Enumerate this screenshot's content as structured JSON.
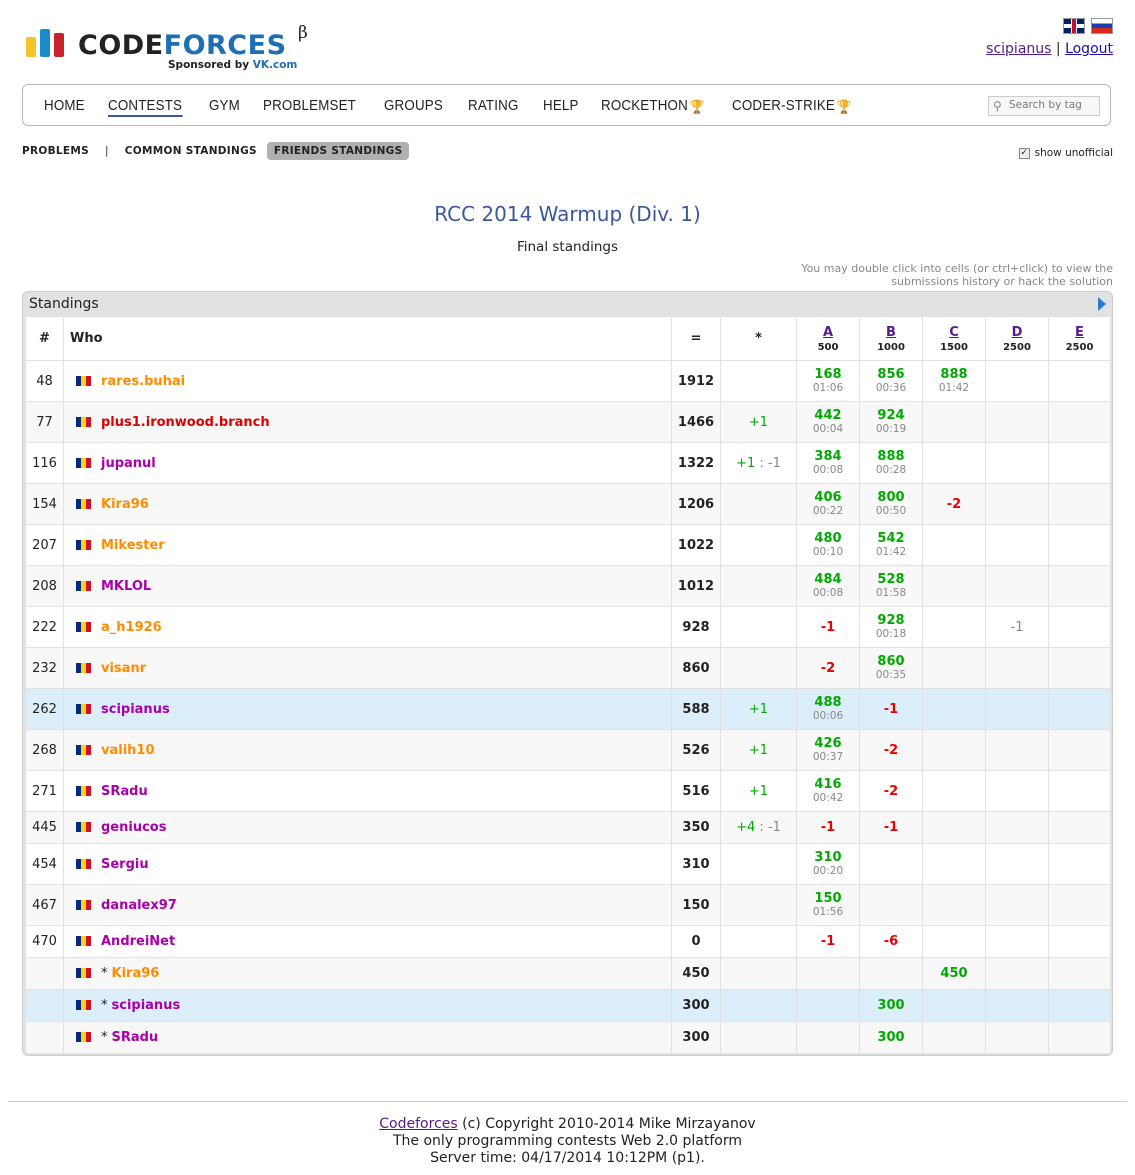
{
  "logo": {
    "word_part1": "CODE",
    "word_part2": "FORCES",
    "beta": "β",
    "sponsor_prefix": "Sponsored by ",
    "sponsor_name": "VK.com"
  },
  "user": {
    "handle": "scipianus",
    "separator": "|",
    "logout": "Logout"
  },
  "menu": {
    "items": [
      "HOME",
      "CONTESTS",
      "GYM",
      "PROBLEMSET",
      "GROUPS",
      "RATING",
      "HELP",
      "ROCKETHON",
      "CODER-STRIKE"
    ],
    "active": "CONTESTS",
    "search_placeholder": "Search by tag"
  },
  "subnav": {
    "problems": "PROBLEMS",
    "sep": "|",
    "common": "COMMON STANDINGS",
    "friends": "FRIENDS STANDINGS",
    "show_unofficial": "show unofficial"
  },
  "contest": {
    "title": "RCC 2014 Warmup (Div. 1)",
    "subtitle": "Final standings",
    "hint": "You may double click into cells (or ctrl+click) to view the submissions history or hack the solution"
  },
  "standings": {
    "caption": "Standings",
    "headers": {
      "rank": "#",
      "who": "Who",
      "points": "=",
      "hacks": "*"
    },
    "problems": [
      {
        "letter": "A",
        "points": "500"
      },
      {
        "letter": "B",
        "points": "1000"
      },
      {
        "letter": "C",
        "points": "1500"
      },
      {
        "letter": "D",
        "points": "2500"
      },
      {
        "letter": "E",
        "points": "2500"
      }
    ],
    "rows": [
      {
        "rank": "48",
        "prefix": "",
        "handle": "rares.buhai",
        "color": "orange",
        "pts": "1912",
        "hacks": "",
        "cells": [
          [
            "168",
            "01:06",
            "a"
          ],
          [
            "856",
            "00:36",
            "a"
          ],
          [
            "888",
            "01:42",
            "a"
          ],
          [
            "",
            "",
            ""
          ],
          [
            "",
            "",
            ""
          ]
        ]
      },
      {
        "rank": "77",
        "prefix": "",
        "handle": "plus1.ironwood.branch",
        "color": "red",
        "pts": "1466",
        "hacks": "+1",
        "cells": [
          [
            "442",
            "00:04",
            "a"
          ],
          [
            "924",
            "00:19",
            "a"
          ],
          [
            "",
            "",
            ""
          ],
          [
            "",
            "",
            ""
          ],
          [
            "",
            "",
            ""
          ]
        ]
      },
      {
        "rank": "116",
        "prefix": "",
        "handle": "jupanul",
        "color": "violet",
        "pts": "1322",
        "hacks": "+1 : -1",
        "cells": [
          [
            "384",
            "00:08",
            "a"
          ],
          [
            "888",
            "00:28",
            "a"
          ],
          [
            "",
            "",
            ""
          ],
          [
            "",
            "",
            ""
          ],
          [
            "",
            "",
            ""
          ]
        ]
      },
      {
        "rank": "154",
        "prefix": "",
        "handle": "Kira96",
        "color": "orange",
        "pts": "1206",
        "hacks": "",
        "cells": [
          [
            "406",
            "00:22",
            "a"
          ],
          [
            "800",
            "00:50",
            "a"
          ],
          [
            "-2",
            "",
            "r"
          ],
          [
            "",
            "",
            ""
          ],
          [
            "",
            "",
            ""
          ]
        ]
      },
      {
        "rank": "207",
        "prefix": "",
        "handle": "Mikester",
        "color": "orange",
        "pts": "1022",
        "hacks": "",
        "cells": [
          [
            "480",
            "00:10",
            "a"
          ],
          [
            "542",
            "01:42",
            "a"
          ],
          [
            "",
            "",
            ""
          ],
          [
            "",
            "",
            ""
          ],
          [
            "",
            "",
            ""
          ]
        ]
      },
      {
        "rank": "208",
        "prefix": "",
        "handle": "MKLOL",
        "color": "violet",
        "pts": "1012",
        "hacks": "",
        "cells": [
          [
            "484",
            "00:08",
            "a"
          ],
          [
            "528",
            "01:58",
            "a"
          ],
          [
            "",
            "",
            ""
          ],
          [
            "",
            "",
            ""
          ],
          [
            "",
            "",
            ""
          ]
        ]
      },
      {
        "rank": "222",
        "prefix": "",
        "handle": "a_h1926",
        "color": "orange",
        "pts": "928",
        "hacks": "",
        "cells": [
          [
            "-1",
            "",
            "r"
          ],
          [
            "928",
            "00:18",
            "a"
          ],
          [
            "",
            "",
            ""
          ],
          [
            "-1",
            "",
            "g"
          ],
          [
            "",
            "",
            ""
          ]
        ]
      },
      {
        "rank": "232",
        "prefix": "",
        "handle": "visanr",
        "color": "orange",
        "pts": "860",
        "hacks": "",
        "cells": [
          [
            "-2",
            "",
            "r"
          ],
          [
            "860",
            "00:35",
            "a"
          ],
          [
            "",
            "",
            ""
          ],
          [
            "",
            "",
            ""
          ],
          [
            "",
            "",
            ""
          ]
        ]
      },
      {
        "rank": "262",
        "prefix": "",
        "handle": "scipianus",
        "color": "violet",
        "pts": "588",
        "hacks": "+1",
        "me": true,
        "cells": [
          [
            "488",
            "00:06",
            "a"
          ],
          [
            "-1",
            "",
            "r"
          ],
          [
            "",
            "",
            ""
          ],
          [
            "",
            "",
            ""
          ],
          [
            "",
            "",
            ""
          ]
        ]
      },
      {
        "rank": "268",
        "prefix": "",
        "handle": "valih10",
        "color": "orange",
        "pts": "526",
        "hacks": "+1",
        "cells": [
          [
            "426",
            "00:37",
            "a"
          ],
          [
            "-2",
            "",
            "r"
          ],
          [
            "",
            "",
            ""
          ],
          [
            "",
            "",
            ""
          ],
          [
            "",
            "",
            ""
          ]
        ]
      },
      {
        "rank": "271",
        "prefix": "",
        "handle": "SRadu",
        "color": "violet",
        "pts": "516",
        "hacks": "+1",
        "cells": [
          [
            "416",
            "00:42",
            "a"
          ],
          [
            "-2",
            "",
            "r"
          ],
          [
            "",
            "",
            ""
          ],
          [
            "",
            "",
            ""
          ],
          [
            "",
            "",
            ""
          ]
        ]
      },
      {
        "rank": "445",
        "prefix": "",
        "handle": "geniucos",
        "color": "violet",
        "pts": "350",
        "hacks": "+4 : -1",
        "short": true,
        "cells": [
          [
            "-1",
            "",
            "r"
          ],
          [
            "-1",
            "",
            "r"
          ],
          [
            "",
            "",
            ""
          ],
          [
            "",
            "",
            ""
          ],
          [
            "",
            "",
            ""
          ]
        ]
      },
      {
        "rank": "454",
        "prefix": "",
        "handle": "Sergiu",
        "color": "violet",
        "pts": "310",
        "hacks": "",
        "cells": [
          [
            "310",
            "00:20",
            "a"
          ],
          [
            "",
            "",
            ""
          ],
          [
            "",
            "",
            ""
          ],
          [
            "",
            "",
            ""
          ],
          [
            "",
            "",
            ""
          ]
        ]
      },
      {
        "rank": "467",
        "prefix": "",
        "handle": "danalex97",
        "color": "violet",
        "pts": "150",
        "hacks": "",
        "cells": [
          [
            "150",
            "01:56",
            "a"
          ],
          [
            "",
            "",
            ""
          ],
          [
            "",
            "",
            ""
          ],
          [
            "",
            "",
            ""
          ],
          [
            "",
            "",
            ""
          ]
        ]
      },
      {
        "rank": "470",
        "prefix": "",
        "handle": "AndreiNet",
        "color": "violet",
        "pts": "0",
        "hacks": "",
        "short": true,
        "cells": [
          [
            "-1",
            "",
            "r"
          ],
          [
            "-6",
            "",
            "r"
          ],
          [
            "",
            "",
            ""
          ],
          [
            "",
            "",
            ""
          ],
          [
            "",
            "",
            ""
          ]
        ]
      },
      {
        "rank": "",
        "prefix": "*",
        "handle": "Kira96",
        "color": "orange",
        "pts": "450",
        "hacks": "",
        "short": true,
        "cells": [
          [
            "",
            "",
            ""
          ],
          [
            "",
            "",
            ""
          ],
          [
            "450",
            "",
            "a"
          ],
          [
            "",
            "",
            ""
          ],
          [
            "",
            "",
            ""
          ]
        ]
      },
      {
        "rank": "",
        "prefix": "*",
        "handle": "scipianus",
        "color": "violet",
        "pts": "300",
        "hacks": "",
        "short": true,
        "me": true,
        "cells": [
          [
            "",
            "",
            ""
          ],
          [
            "300",
            "",
            "a"
          ],
          [
            "",
            "",
            ""
          ],
          [
            "",
            "",
            ""
          ],
          [
            "",
            "",
            ""
          ]
        ]
      },
      {
        "rank": "",
        "prefix": "*",
        "handle": "SRadu",
        "color": "violet",
        "pts": "300",
        "hacks": "",
        "short": true,
        "cells": [
          [
            "",
            "",
            ""
          ],
          [
            "300",
            "",
            "a"
          ],
          [
            "",
            "",
            ""
          ],
          [
            "",
            "",
            ""
          ],
          [
            "",
            "",
            ""
          ]
        ]
      }
    ]
  },
  "footer": {
    "brand": "Codeforces",
    "copyright": " (c) Copyright 2010-2014 Mike Mirzayanov",
    "line2": "The only programming contests Web 2.0 platform",
    "line3": "Server time: 04/17/2014 10:12PM (p1)."
  },
  "colors": {
    "accepted": "#00aa00",
    "rejected": "#ee0000",
    "orange_handle": "#ff8c00",
    "red_handle": "#dd0000",
    "violet_handle": "#aa00aa",
    "title_blue": "#3b5998"
  }
}
